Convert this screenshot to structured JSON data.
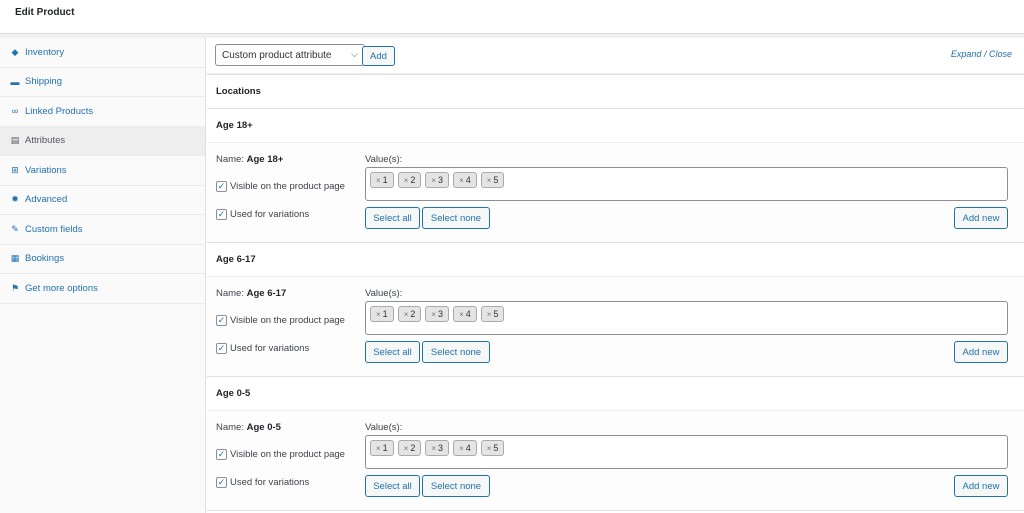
{
  "header": {
    "title": "Edit Product"
  },
  "sidebar": {
    "items": [
      {
        "label": "Inventory",
        "icon": "tag-icon",
        "glyph": "◆"
      },
      {
        "label": "Shipping",
        "icon": "truck-icon",
        "glyph": "▬"
      },
      {
        "label": "Linked Products",
        "icon": "link-icon",
        "glyph": "∞"
      },
      {
        "label": "Attributes",
        "icon": "table-icon",
        "glyph": "▤"
      },
      {
        "label": "Variations",
        "icon": "grid-icon",
        "glyph": "⊞"
      },
      {
        "label": "Advanced",
        "icon": "gear-icon",
        "glyph": "✹"
      },
      {
        "label": "Custom fields",
        "icon": "wrench-icon",
        "glyph": "✎"
      },
      {
        "label": "Bookings",
        "icon": "calendar-icon",
        "glyph": "▦"
      },
      {
        "label": "Get more options",
        "icon": "plugin-icon",
        "glyph": "⚑"
      }
    ]
  },
  "toolbar": {
    "select_value": "Custom product attribute",
    "add_label": "Add",
    "expand_label": "Expand",
    "separator": "/",
    "close_label": "Close"
  },
  "labels": {
    "locations": "Locations",
    "name_prefix": "Name:",
    "values_label": "Value(s):",
    "visible_label": "Visible on the product page",
    "variations_label": "Used for variations",
    "select_all": "Select all",
    "select_none": "Select none",
    "add_new": "Add new",
    "remove_mark": "×"
  },
  "attributes": [
    {
      "name": "Age 18+",
      "values": [
        "1",
        "2",
        "3",
        "4",
        "5"
      ],
      "visible": true,
      "used_for_variations": true
    },
    {
      "name": "Age 6-17",
      "values": [
        "1",
        "2",
        "3",
        "4",
        "5"
      ],
      "visible": true,
      "used_for_variations": true
    },
    {
      "name": "Age 0-5",
      "values": [
        "1",
        "2",
        "3",
        "4",
        "5"
      ],
      "visible": true,
      "used_for_variations": true
    }
  ],
  "colors": {
    "accent": "#2271b1",
    "text": "#1d2327"
  }
}
